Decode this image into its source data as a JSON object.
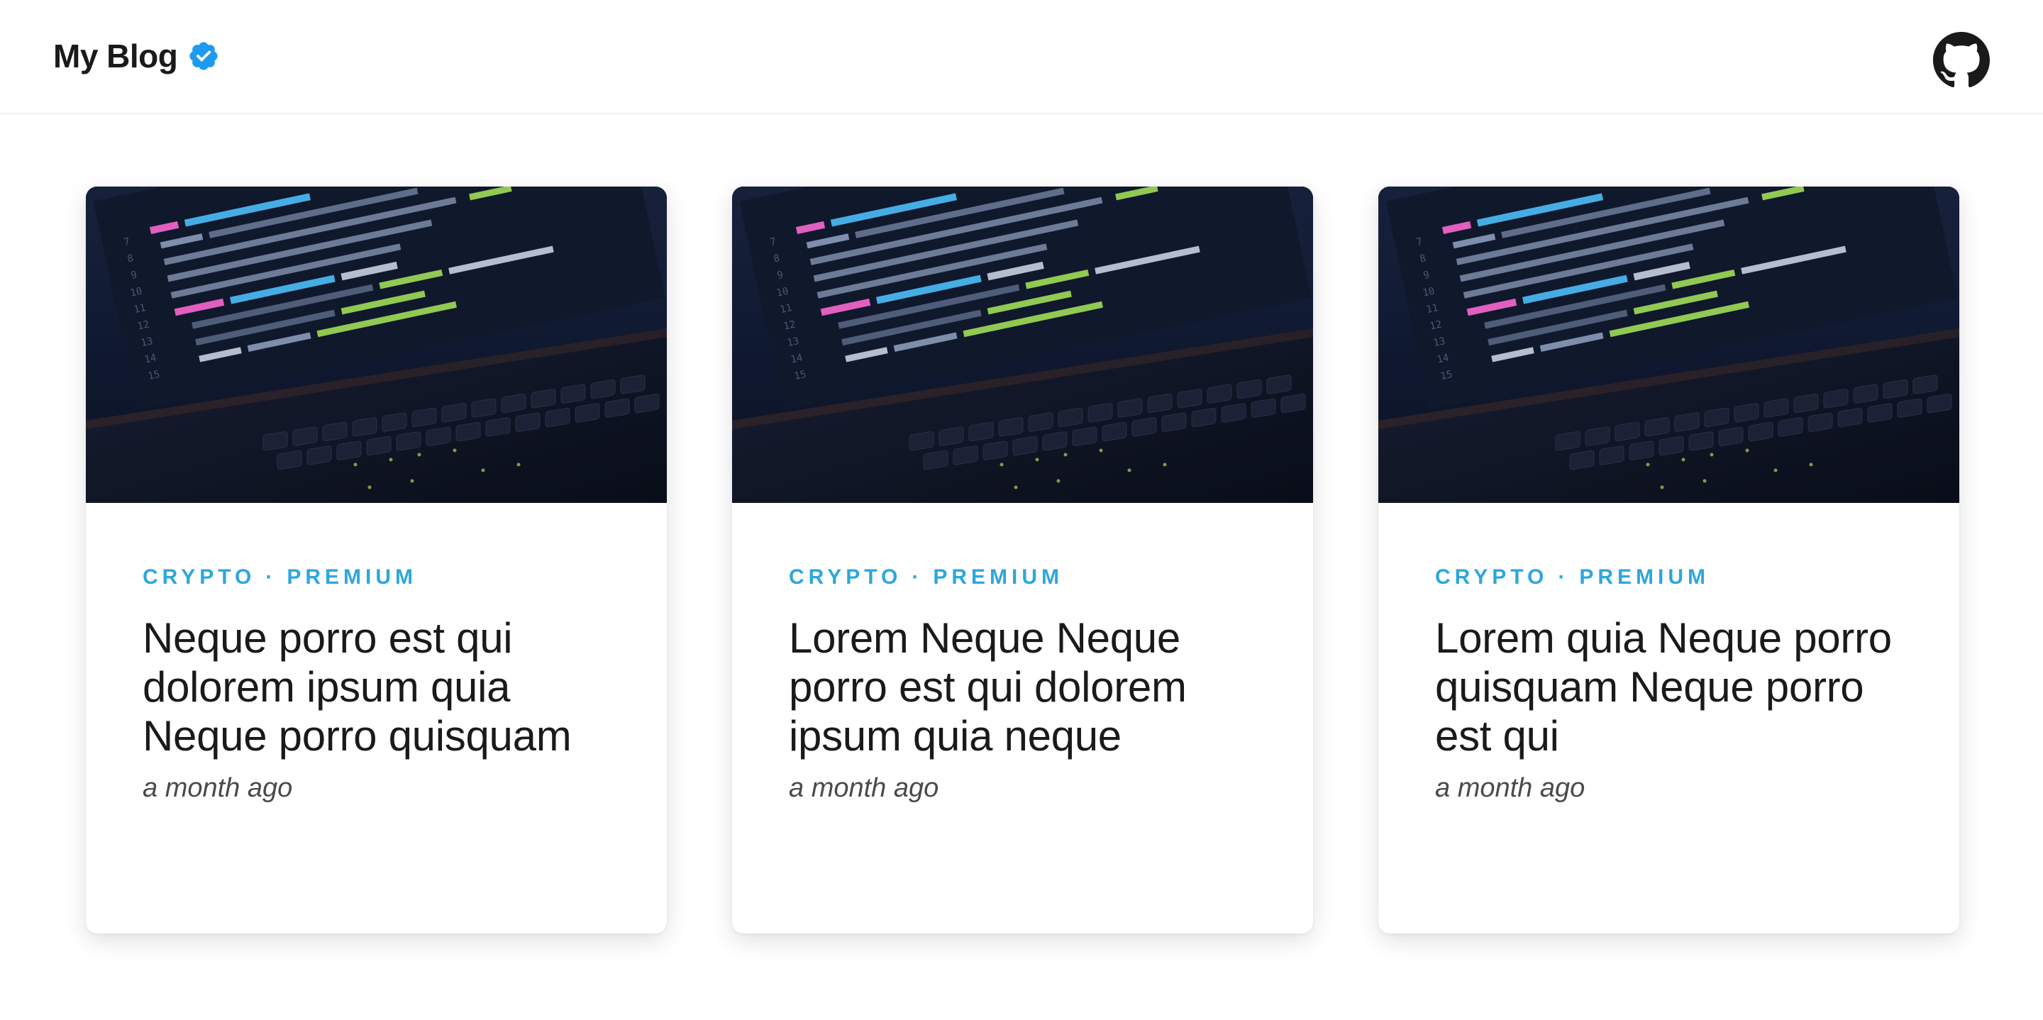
{
  "header": {
    "title": "My Blog",
    "verified_icon": "verified-badge-icon",
    "github_icon": "github-icon"
  },
  "colors": {
    "accent": "#2ea7db",
    "verified": "#1d9bf0",
    "text": "#1a1a1a",
    "muted": "#4a4a4a"
  },
  "posts": [
    {
      "tag1": "CRYPTO",
      "separator": "·",
      "tag2": "PREMIUM",
      "title": "Neque porro est qui dolorem ipsum quia Neque porro quisquam",
      "date": "a month ago"
    },
    {
      "tag1": "CRYPTO",
      "separator": "·",
      "tag2": "PREMIUM",
      "title": "Lorem Neque Neque porro est qui dolorem ipsum quia neque",
      "date": "a month ago"
    },
    {
      "tag1": "CRYPTO",
      "separator": "·",
      "tag2": "PREMIUM",
      "title": "Lorem quia Neque porro quisquam Neque porro est qui",
      "date": "a month ago"
    }
  ]
}
